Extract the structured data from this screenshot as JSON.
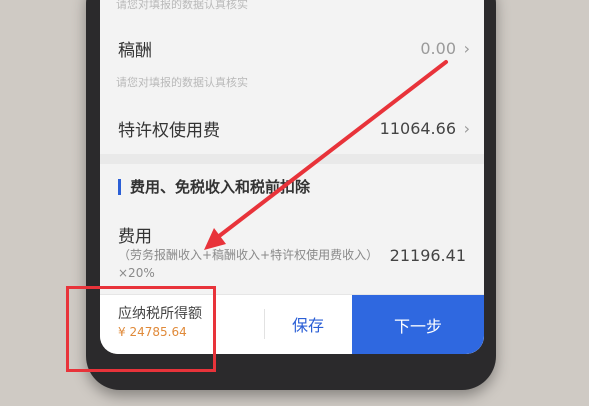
{
  "top_hint": "请您对填报的数据认真核实",
  "rows": [
    {
      "label": "稿酬",
      "value": "0.00",
      "hint": "请您对填报的数据认真核实"
    },
    {
      "label": "特许权使用费",
      "value": "11064.66"
    }
  ],
  "section": {
    "title": "费用、免税收入和税前扣除"
  },
  "fee": {
    "label": "费用",
    "desc": "（劳务报酬收入+稿酬收入+特许权使用费收入）×20%",
    "value": "21196.41"
  },
  "bottom": {
    "tax_label": "应纳税所得额",
    "tax_value": "¥ 24785.64",
    "save_label": "保存",
    "next_label": "下一步"
  },
  "colors": {
    "accent": "#2f68e0",
    "highlight": "#e8333a",
    "tax_value": "#e08a3a"
  }
}
